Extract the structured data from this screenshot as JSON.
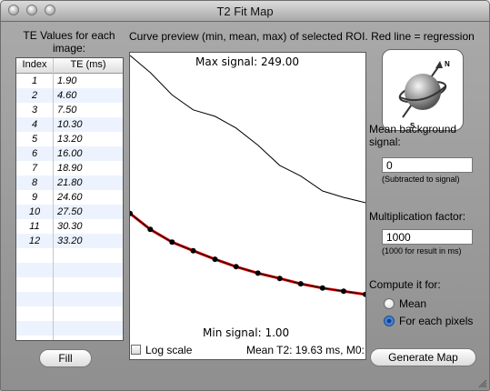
{
  "window": {
    "title": "T2 Fit Map"
  },
  "te_panel": {
    "heading_line1": "TE Values for each",
    "heading_line2": "image:",
    "columns": [
      "Index",
      "TE (ms)"
    ],
    "rows": [
      {
        "index": "1",
        "te": "1.90"
      },
      {
        "index": "2",
        "te": "4.60"
      },
      {
        "index": "3",
        "te": "7.50"
      },
      {
        "index": "4",
        "te": "10.30"
      },
      {
        "index": "5",
        "te": "13.20"
      },
      {
        "index": "6",
        "te": "16.00"
      },
      {
        "index": "7",
        "te": "18.90"
      },
      {
        "index": "8",
        "te": "21.80"
      },
      {
        "index": "9",
        "te": "24.60"
      },
      {
        "index": "10",
        "te": "27.50"
      },
      {
        "index": "11",
        "te": "30.30"
      },
      {
        "index": "12",
        "te": "33.20"
      }
    ],
    "fill_button": "Fill"
  },
  "preview": {
    "caption": "Curve preview (min, mean, max) of selected ROI. Red line = regression",
    "max_label": "Max signal: 249.00",
    "min_label": "Min signal: 1.00",
    "log_scale_label": "Log scale",
    "log_scale_checked": false,
    "status": "Mean T2: 19.63 ms, M0:"
  },
  "chart_data": {
    "type": "line",
    "x": [
      1.9,
      4.6,
      7.5,
      10.3,
      13.2,
      16.0,
      18.9,
      21.8,
      24.6,
      27.5,
      30.3,
      33.2
    ],
    "ylim": [
      1,
      249
    ],
    "series": [
      {
        "values": [
          249,
          233,
          212,
          198,
          192,
          181,
          165,
          146,
          136,
          122,
          116,
          111
        ],
        "color": "#000000"
      },
      {
        "values": [
          101,
          86,
          74,
          66,
          58,
          51,
          45,
          40,
          35,
          31,
          28,
          25
        ],
        "color": "#000000"
      },
      {
        "values": [
          101,
          86,
          74,
          66,
          58,
          51,
          45,
          40,
          35,
          31,
          28,
          25
        ],
        "color": "#e00000"
      }
    ]
  },
  "settings": {
    "background_label_line1": "Mean background",
    "background_label_line2": "signal:",
    "background_value": "0",
    "background_hint": "(Subtracted to signal)",
    "multiplication_label": "Multiplication factor:",
    "multiplication_value": "1000",
    "multiplication_hint": "(1000 for result in ms)",
    "compute_label": "Compute it for:",
    "options": [
      "Mean",
      "For each pixels"
    ],
    "selected_option": "For each pixels",
    "generate_button": "Generate Map"
  },
  "logo": {
    "n": "N",
    "s": "S"
  },
  "colors": {
    "accent": "#2c66c8",
    "regression": "#e00000"
  }
}
